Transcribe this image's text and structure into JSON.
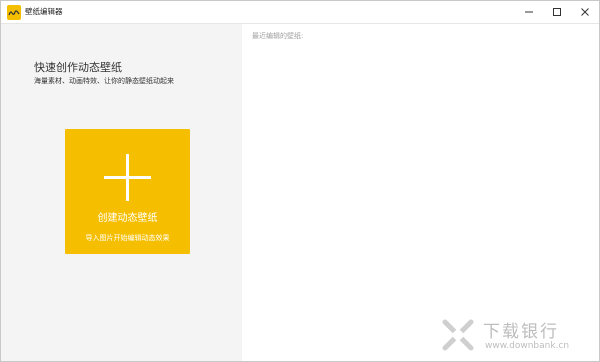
{
  "window": {
    "title": "壁纸编辑器",
    "controls": {
      "minimize": "—",
      "maximize": "□",
      "close": "✕"
    }
  },
  "left_panel": {
    "heading": "快速创作动态壁纸",
    "subheading": "海量素材、动画特效、让你的静态壁纸动起来",
    "create_card": {
      "title": "创建动态壁纸",
      "subtitle": "导入图片开始编辑动态效果"
    }
  },
  "right_panel": {
    "recent_label": "最近编辑的壁纸:"
  },
  "watermark": {
    "brand": "下载银行",
    "site": "www.downbank.cn"
  },
  "colors": {
    "accent": "#f5bf00",
    "left_panel_bg": "#f4f4f4",
    "watermark": "#bdbdbd"
  },
  "icons": {
    "app": "wallpaper-app-icon",
    "create": "plus-icon",
    "watermark": "x-logo-icon"
  }
}
